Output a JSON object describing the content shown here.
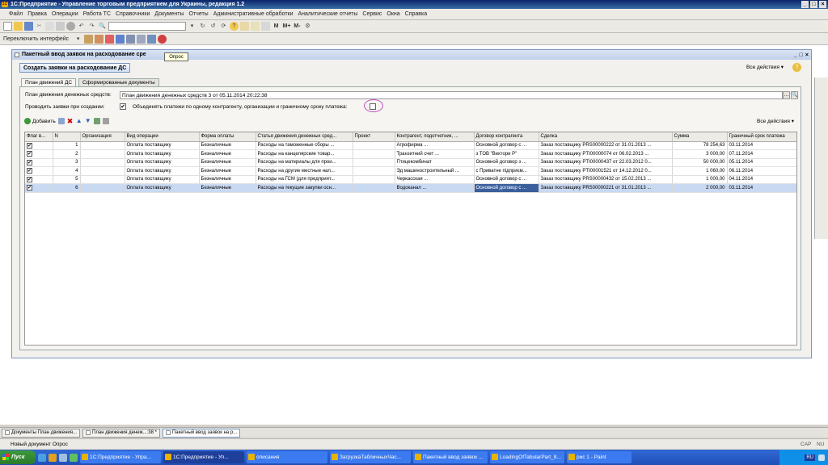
{
  "app": {
    "title": "1С:Предприятие - Управление торговым предприятием для Украины, редакция 1.2",
    "logo": "1C"
  },
  "menu": [
    "Файл",
    "Правка",
    "Операции",
    "Работа ТС",
    "Справочники",
    "Документы",
    "Отчеты",
    "Административные обработки",
    "Аналитические отчеты",
    "Сервис",
    "Окна",
    "Справка"
  ],
  "toolbar2": {
    "interface_label": "Переключить интерфейс"
  },
  "doc": {
    "title": "Пакетный ввод заявок на расходование сре",
    "tooltip": "Опрос",
    "create_button": "Создать заявки на расходование ДС",
    "all_actions": "Все действия",
    "tabs": [
      "План движений ДС",
      "Сформированные документы"
    ],
    "plan_label": "План движения денежных средств:",
    "plan_value": "План движения денежных средств 3 от 05.11.2014 20:22:38",
    "confirm_label": "Проводить заявки при создании:",
    "combine_label": "Объединять платежи по одному контрагенту, организации и граничному сроку платежа:",
    "add_button": "Добавить",
    "grid_all_actions": "Все действия"
  },
  "grid": {
    "columns": [
      "Флаг в...",
      "N",
      "Организация",
      "Вид операции",
      "Форма оплаты",
      "Статья движения денежных сред...",
      "Проект",
      "Контрагент, подотчетник, ...",
      "Договор контрагента",
      "Сделка",
      "Сумма",
      "Граничный срок платежа"
    ],
    "rows": [
      {
        "flag": "✔",
        "n": "1",
        "org": "",
        "op": "Оплата поставщику",
        "pay": "Безналичные",
        "article": "Расходы на таможенные сборы ...",
        "project": "",
        "counterparty": "Агрофирма ...",
        "contract": "Основной договор с ...",
        "deal": "Заказ поставщику PRS00000222 от 31.01.2013 ...",
        "sum": "78 254,63",
        "due": "03.11.2014"
      },
      {
        "flag": "✔",
        "n": "2",
        "org": "",
        "op": "Оплата поставщику",
        "pay": "Безналичные",
        "article": "Расходы на канцелярские товар...",
        "project": "",
        "counterparty": "Транзитний счет ...",
        "contract": "з ТОВ \"Вектори Р\"",
        "deal": "Заказ поставщику PTI00000074 от 06.02.2013 ...",
        "sum": "3 000,00",
        "due": "07.11.2014"
      },
      {
        "flag": "✔",
        "n": "3",
        "org": "",
        "op": "Оплата поставщику",
        "pay": "Безналичные",
        "article": "Расходы на материалы для прои...",
        "project": "",
        "counterparty": "Птицекомбинат",
        "contract": "Основной договор з ...",
        "deal": "Заказ поставщику PTI00000437 от 22.03.2012 0...",
        "sum": "50 000,00",
        "due": "05.11.2014"
      },
      {
        "flag": "✔",
        "n": "4",
        "org": "",
        "op": "Оплата поставщику",
        "pay": "Безналичные",
        "article": "Расходы на другие местные нал...",
        "project": "",
        "counterparty": "Эд машиностроительный ...",
        "contract": "с Приватне підприєм...",
        "deal": "Заказ поставщику PTI00001521 от 14.12.2012 0...",
        "sum": "1 060,00",
        "due": "06.11.2014"
      },
      {
        "flag": "✔",
        "n": "5",
        "org": "",
        "op": "Оплата поставщику",
        "pay": "Безналичные",
        "article": "Расходы на ГСМ (для предприят...",
        "project": "",
        "counterparty": "Черкасская ...",
        "contract": "Основной договор с ...",
        "deal": "Заказ поставщику PRS00000432 от 15.02.2013 ...",
        "sum": "1 000,00",
        "due": "04.11.2014"
      },
      {
        "flag": "✔",
        "n": "6",
        "org": "",
        "op": "Оплата поставщику",
        "pay": "Безналичные",
        "article": "Расходы на текущие закупки осн...",
        "project": "",
        "counterparty": "Водоканал ...",
        "contract": "Основной договор с ...",
        "deal": "Заказ поставщику PRS00000221 от 31.01.2013 ...",
        "sum": "2 000,00",
        "due": "03.11.2014"
      }
    ]
  },
  "windows_bar": [
    "Документы План движения...",
    "План движения денеж...:38 *",
    "Пакетный ввод заявок на р..."
  ],
  "status": {
    "text": "Новый документ Опрос",
    "cap": "CAP",
    "num": "NU"
  },
  "taskbar": {
    "start": "Пуск",
    "tasks": [
      "1С:Предприятие - Упра...",
      "1С:Предприятие - Уп...",
      "описания",
      "ЗагрузкаТабличныхЧас...",
      "Пакетный ввод заявок ...",
      "LoadingOfTabularPart_8...",
      "рис 1 - Paint"
    ],
    "lang": "RU"
  }
}
